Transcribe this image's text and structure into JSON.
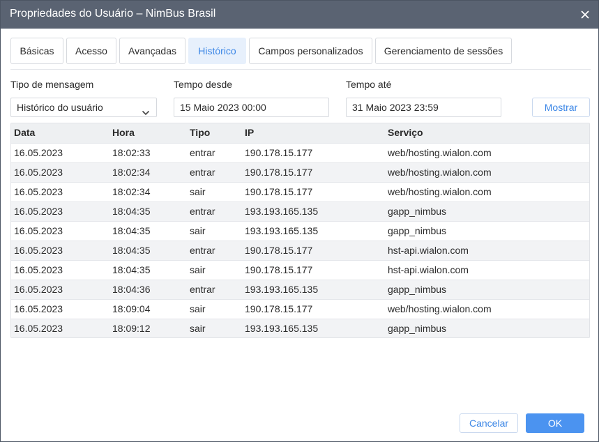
{
  "window": {
    "title": "Propriedades do Usuário – NimBus Brasil",
    "close_icon": "close-icon"
  },
  "tabs": [
    {
      "label": "Básicas",
      "active": false
    },
    {
      "label": "Acesso",
      "active": false
    },
    {
      "label": "Avançadas",
      "active": false
    },
    {
      "label": "Histórico",
      "active": true
    },
    {
      "label": "Campos personalizados",
      "active": false
    },
    {
      "label": "Gerenciamento de sessões",
      "active": false
    }
  ],
  "filters": {
    "message_type_label": "Tipo de mensagem",
    "message_type_value": "Histórico do usuário",
    "from_label": "Tempo desde",
    "from_value": "15 Maio 2023 00:00",
    "to_label": "Tempo até",
    "to_value": "31 Maio 2023 23:59",
    "show_label": "Mostrar"
  },
  "table": {
    "columns": [
      "Data",
      "Hora",
      "Tipo",
      "IP",
      "Serviço"
    ],
    "rows": [
      [
        "16.05.2023",
        "18:02:33",
        "entrar",
        "190.178.15.177",
        "web/hosting.wialon.com"
      ],
      [
        "16.05.2023",
        "18:02:34",
        "entrar",
        "190.178.15.177",
        "web/hosting.wialon.com"
      ],
      [
        "16.05.2023",
        "18:02:34",
        "sair",
        "190.178.15.177",
        "web/hosting.wialon.com"
      ],
      [
        "16.05.2023",
        "18:04:35",
        "entrar",
        "193.193.165.135",
        "gapp_nimbus"
      ],
      [
        "16.05.2023",
        "18:04:35",
        "sair",
        "193.193.165.135",
        "gapp_nimbus"
      ],
      [
        "16.05.2023",
        "18:04:35",
        "entrar",
        "190.178.15.177",
        "hst-api.wialon.com"
      ],
      [
        "16.05.2023",
        "18:04:35",
        "sair",
        "190.178.15.177",
        "hst-api.wialon.com"
      ],
      [
        "16.05.2023",
        "18:04:36",
        "entrar",
        "193.193.165.135",
        "gapp_nimbus"
      ],
      [
        "16.05.2023",
        "18:09:04",
        "sair",
        "190.178.15.177",
        "web/hosting.wialon.com"
      ],
      [
        "16.05.2023",
        "18:09:12",
        "sair",
        "193.193.165.135",
        "gapp_nimbus"
      ]
    ]
  },
  "footer": {
    "cancel_label": "Cancelar",
    "ok_label": "OK"
  },
  "colors": {
    "titlebar": "#5a6372",
    "accent": "#3b86e6",
    "primary_button": "#4b93f0",
    "active_tab_bg": "#e7f0fc"
  }
}
